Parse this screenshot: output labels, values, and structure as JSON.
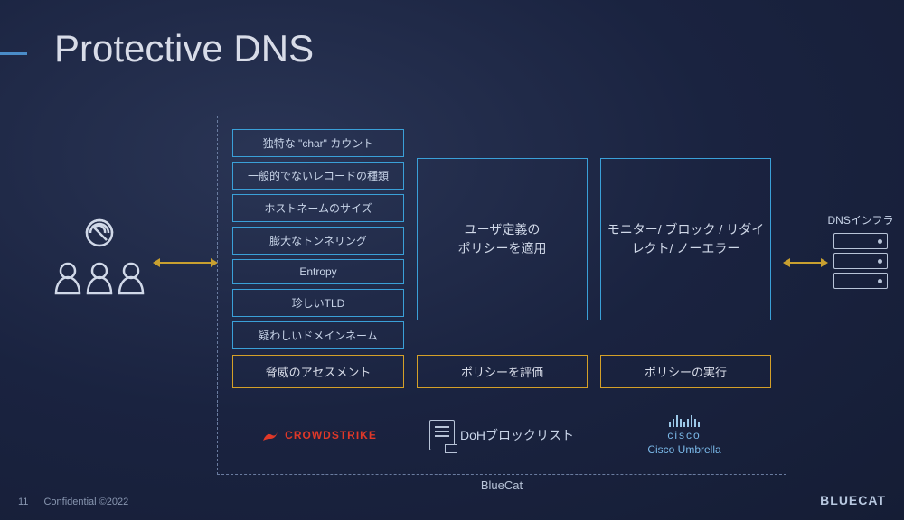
{
  "title": "Protective DNS",
  "threat_checks": [
    "独特な \"char\" カウント",
    "一般的でないレコードの種類",
    "ホストネームのサイズ",
    "膨大なトンネリング",
    "Entropy",
    "珍しいTLD",
    "疑わしいドメインネーム"
  ],
  "policy_box": "ユーザ定義の\nポリシーを適用",
  "action_box": "モニター/ ブロック / リダイレクト/ ノーエラー",
  "yellow": {
    "assess": "脅威のアセスメント",
    "eval": "ポリシーを評価",
    "exec": "ポリシーの実行"
  },
  "vendors": {
    "crowdstrike": "CROWDSTRIKE",
    "doh": "DoHブロックリスト",
    "cisco_top": "cisco",
    "cisco_bottom": "Cisco Umbrella"
  },
  "container_label": "BlueCat",
  "dns_infra": "DNSインフラ",
  "footer": {
    "page": "11",
    "confidential": "Confidential ©2022",
    "brand": "BLUECAT"
  }
}
